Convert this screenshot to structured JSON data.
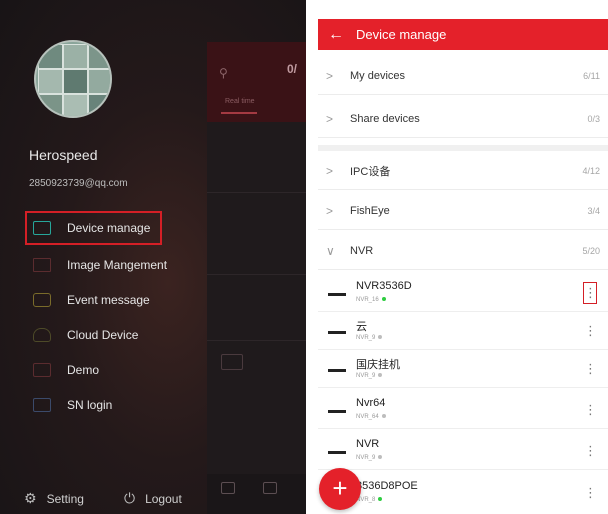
{
  "drawer": {
    "username": "Herospeed",
    "email": "2850923739@qq.com",
    "menu": [
      {
        "label": "Device manage",
        "icon": "folder-icon"
      },
      {
        "label": "Image Mangement",
        "icon": "image-icon"
      },
      {
        "label": "Event message",
        "icon": "event-icon"
      },
      {
        "label": "Cloud Device",
        "icon": "cloud-icon"
      },
      {
        "label": "Demo",
        "icon": "demo-icon"
      },
      {
        "label": "SN login",
        "icon": "sn-icon"
      }
    ],
    "setting_label": "Setting",
    "logout_label": "Logout",
    "behind": {
      "count": "0/",
      "tab_label": "Real time"
    }
  },
  "device_manage": {
    "title": "Device manage",
    "back_icon": "back-arrow-icon",
    "groups_top": [
      {
        "name": "My devices",
        "count": "6/11"
      },
      {
        "name": "Share devices",
        "count": "0/3"
      }
    ],
    "groups_bottom": [
      {
        "name": "IPC设备",
        "count": "4/12",
        "expanded": false
      },
      {
        "name": "FishEye",
        "count": "3/4",
        "expanded": false
      },
      {
        "name": "NVR",
        "count": "5/20",
        "expanded": true
      }
    ],
    "devices": [
      {
        "name": "NVR3536D",
        "sub": "NVR_16",
        "status_color": "#2ecc40"
      },
      {
        "name": "云",
        "sub": "NVR_9",
        "status_color": "#bdbdbd"
      },
      {
        "name": "国庆挂机",
        "sub": "NVR_9",
        "status_color": "#bdbdbd"
      },
      {
        "name": "Nvr64",
        "sub": "NVR_64",
        "status_color": "#bdbdbd"
      },
      {
        "name": "NVR",
        "sub": "NVR_9",
        "status_color": "#bdbdbd"
      },
      {
        "name": "3536D8POE",
        "sub": "NVR_8",
        "status_color": "#2ecc40"
      }
    ],
    "fab_label": "+"
  }
}
